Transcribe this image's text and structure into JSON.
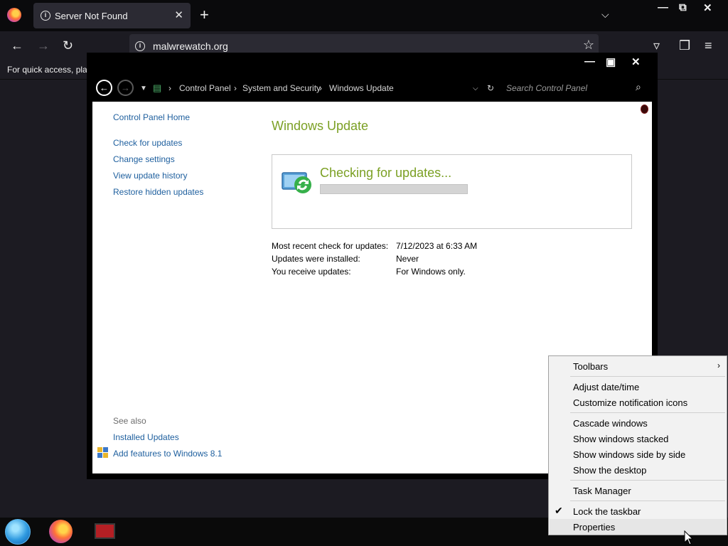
{
  "browser": {
    "tab_title": "Server Not Found",
    "tab_close": "✕",
    "new_tab": "+",
    "url": "malwrewatch.org",
    "bookmarks_text": "For quick access, plac"
  },
  "control_panel": {
    "breadcrumbs": [
      "Control Panel",
      "System and Security",
      "Windows Update"
    ],
    "search_placeholder": "Search Control Panel",
    "sidebar": {
      "home": "Control Panel Home",
      "links": [
        "Check for updates",
        "Change settings",
        "View update history",
        "Restore hidden updates"
      ],
      "see_also_label": "See also",
      "see_also_links": [
        "Installed Updates",
        "Add features to Windows 8.1"
      ]
    },
    "page_title": "Windows Update",
    "status": {
      "text": "Checking for updates...",
      "progress_fraction": 0.0
    },
    "info": [
      {
        "label": "Most recent check for updates:",
        "value": "7/12/2023 at 6:33 AM"
      },
      {
        "label": "Updates were installed:",
        "value": "Never"
      },
      {
        "label": "You receive updates:",
        "value": "For Windows only."
      }
    ]
  },
  "context_menu": {
    "items": [
      {
        "label": "Toolbars",
        "submenu": true
      },
      {
        "label": "Adjust date/time"
      },
      {
        "label": "Customize notification icons"
      },
      {
        "label": "Cascade windows"
      },
      {
        "label": "Show windows stacked"
      },
      {
        "label": "Show windows side by side"
      },
      {
        "label": "Show the desktop"
      },
      {
        "label": "Task Manager"
      },
      {
        "label": "Lock the taskbar",
        "checked": true
      },
      {
        "label": "Properties"
      }
    ]
  },
  "colors": {
    "accent_green": "#7ba024",
    "link_blue": "#1e5f9e"
  }
}
